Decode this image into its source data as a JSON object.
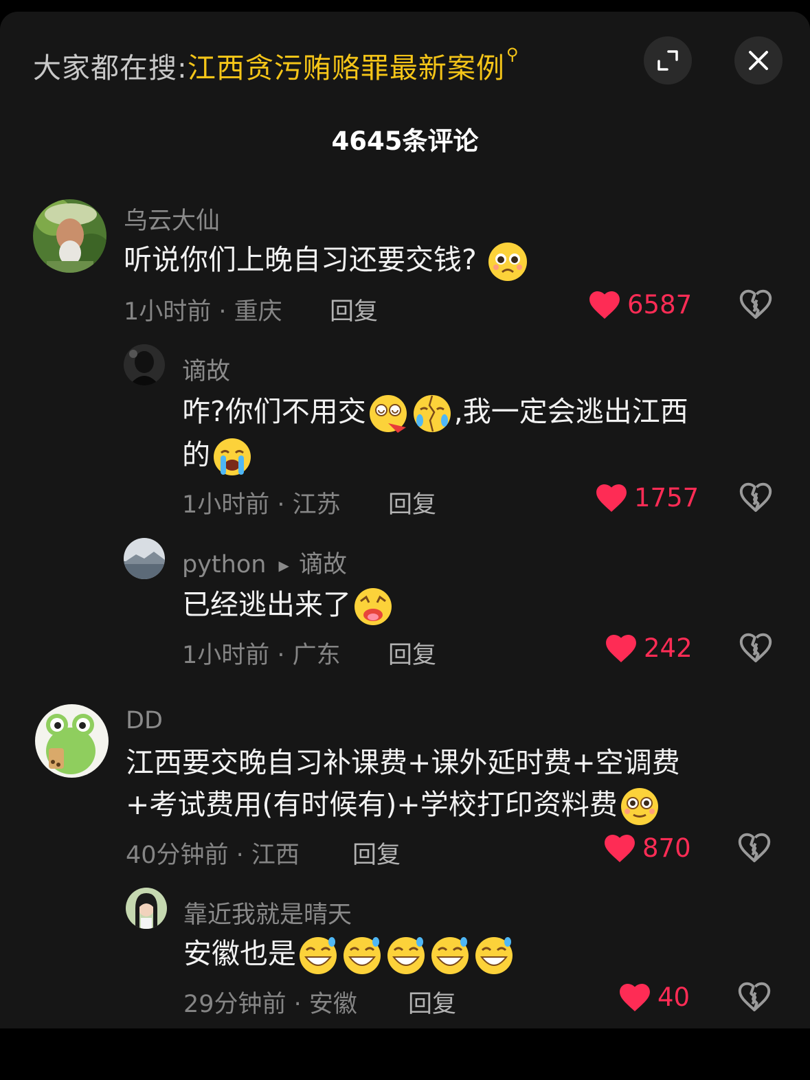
{
  "header": {
    "search_prefix": "大家都在搜:",
    "search_term": "江西贪污贿赂罪最新案例",
    "expand_icon": "expand-icon",
    "close_icon": "close-icon"
  },
  "comment_count": "4645条评论",
  "comments": [
    {
      "author": "乌云大仙",
      "text": "听说你们上晚自习还要交钱?",
      "meta": "1小时前 · 重庆",
      "reply": "回复",
      "likes": "6587"
    },
    {
      "author": "谪故",
      "text_a": "咋?你们不用交",
      "text_b": ",我一定会逃出江西",
      "text_c": "的",
      "meta": "1小时前 · 江苏",
      "reply": "回复",
      "likes": "1757"
    },
    {
      "author": "python",
      "reply_to": "谪故",
      "text": "已经逃出来了",
      "meta": "1小时前 · 广东",
      "reply": "回复",
      "likes": "242"
    },
    {
      "author": "DD",
      "text_line1": "江西要交晚自习补课费+课外延时费+空调费",
      "text_line2": "+考试费用(有时候有)+学校打印资料费",
      "meta": "40分钟前 · 江西",
      "reply": "回复",
      "likes": "870"
    },
    {
      "author": "靠近我就是晴天",
      "text": "安徽也是",
      "meta": "29分钟前 · 安徽",
      "reply": "回复",
      "likes": "40"
    }
  ],
  "colors": {
    "accent_yellow": "#f5c518",
    "like_red": "#fe2c55",
    "panel_bg": "#161616"
  }
}
